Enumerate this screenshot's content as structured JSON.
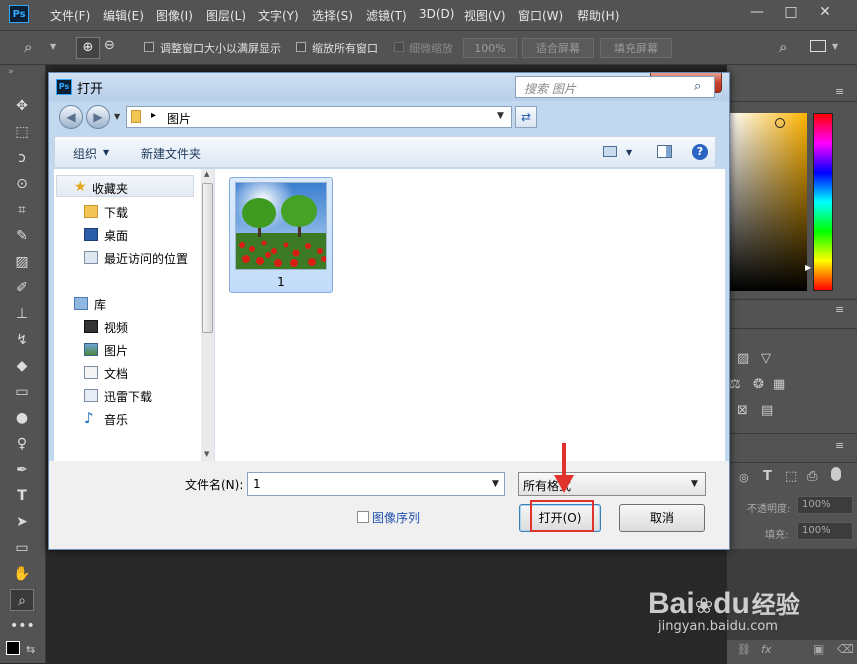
{
  "menubar": {
    "logo": "Ps",
    "items": [
      "文件(F)",
      "编辑(E)",
      "图像(I)",
      "图层(L)",
      "文字(Y)",
      "选择(S)",
      "滤镜(T)",
      "3D(D)",
      "视图(V)",
      "窗口(W)",
      "帮助(H)"
    ],
    "window_controls": [
      "—",
      "□",
      "✕"
    ]
  },
  "options_bar": {
    "resize_windows_label": "调整窗口大小以满屏显示",
    "zoom_all_windows_label": "缩放所有窗口",
    "scrubby_zoom_label": "细微缩放",
    "zoom_level": "100%",
    "fit_screen_label": "适合屏幕",
    "fill_screen_label": "填充屏幕"
  },
  "right_panel": {
    "opacity_label": "不透明度:",
    "opacity_value": "100%",
    "fill_label": "填充:",
    "fill_value": "100%"
  },
  "dialog": {
    "title": "打开",
    "icon": "Ps",
    "address": {
      "path_separator": "▸",
      "folder": "图片"
    },
    "search_placeholder": "搜索 图片",
    "commands": {
      "organize": "组织",
      "new_folder": "新建文件夹"
    },
    "nav": {
      "favorites": "收藏夹",
      "favorite_items": [
        "下载",
        "桌面",
        "最近访问的位置"
      ],
      "library": "库",
      "library_items": [
        "视频",
        "图片",
        "文档",
        "迅雷下载",
        "音乐"
      ]
    },
    "files": [
      {
        "name": "1"
      }
    ],
    "filename_label": "文件名(N):",
    "filename_value": "1",
    "filter_value": "所有格式",
    "image_sequence_label": "图像序列",
    "open_button": "打开(O)",
    "cancel_button": "取消"
  },
  "watermark": {
    "brand": "Bai",
    "brand2": "du",
    "cn": "经验",
    "url": "jingyan.baidu.com"
  },
  "colors": {
    "ps_gray": "#535353",
    "dialog_frame": "#c2d8ee",
    "highlight_red": "#e0322a"
  }
}
